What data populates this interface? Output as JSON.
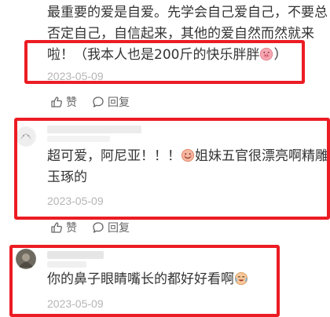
{
  "comment1": {
    "lines": [
      "最重要的爱是自爱。先学会自己爱自己，不要总",
      "否定自己，自信起来，其他的爱自然而然就来",
      "啦！（我本人也是200斤的快乐胖胖"
    ],
    "line3_tail": "）",
    "date": "2023-05-09",
    "like_label": "赞",
    "reply_label": "回复"
  },
  "comment2": {
    "line1_a": "超可爱，阿尼亚！！！",
    "line1_b": "姐妹五官很漂亮啊精雕",
    "line2": "玉琢的",
    "date": "2023-05-09",
    "like_label": "赞",
    "reply_label": "回复"
  },
  "comment3": {
    "text": "你的鼻子眼睛嘴长的都好好看啊",
    "date": "2023-05-09"
  },
  "colors": {
    "highlight_box": "#ec1c24",
    "date_text": "#b5b5b5"
  },
  "icons": [
    "pig-face-emoji",
    "peach-face-emoji",
    "crying-laugh-emoji",
    "thumbs-up-icon",
    "comment-bubble-icon"
  ]
}
